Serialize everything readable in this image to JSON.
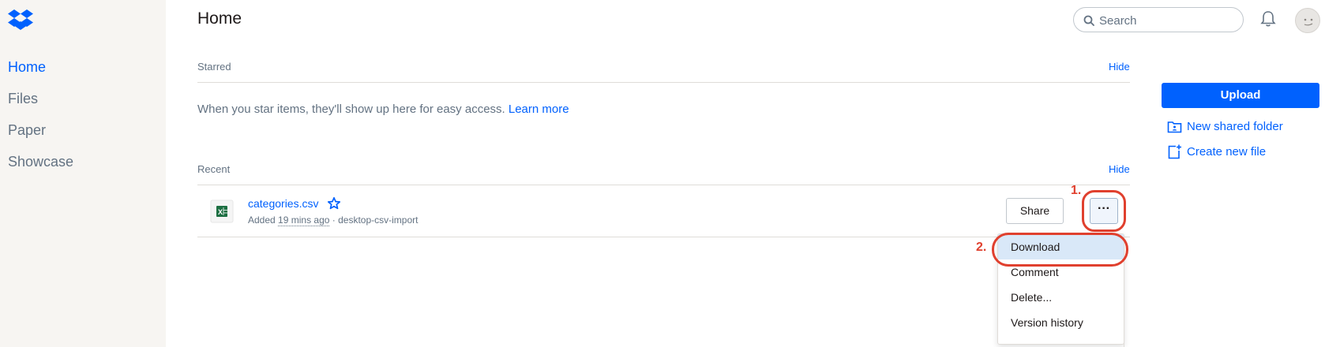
{
  "sidebar": {
    "items": [
      {
        "label": "Home",
        "active": true
      },
      {
        "label": "Files",
        "active": false
      },
      {
        "label": "Paper",
        "active": false
      },
      {
        "label": "Showcase",
        "active": false
      }
    ]
  },
  "header": {
    "title": "Home",
    "search_placeholder": "Search",
    "icons": [
      "search-icon",
      "bell-icon",
      "avatar"
    ]
  },
  "starred": {
    "label": "Starred",
    "hide_label": "Hide",
    "empty_text": "When you star items, they'll show up here for easy access.",
    "learn_more": "Learn more"
  },
  "recent": {
    "label": "Recent",
    "hide_label": "Hide",
    "files": [
      {
        "name": "categories.csv",
        "meta_prefix": "Added",
        "time": "19 mins ago",
        "meta_suffix": "· desktop-csv-import",
        "icon": "spreadsheet-icon",
        "share_label": "Share",
        "more_label": "···"
      }
    ]
  },
  "context_menu": {
    "items": [
      {
        "label": "Download",
        "highlighted": true
      },
      {
        "label": "Comment",
        "highlighted": false
      },
      {
        "label": "Delete...",
        "highlighted": false
      },
      {
        "label": "Version history",
        "highlighted": false
      }
    ]
  },
  "annotations": {
    "step1": "1.",
    "step2": "2."
  },
  "right_panel": {
    "upload_label": "Upload",
    "new_shared_folder": "New shared folder",
    "create_new_file": "Create new file"
  },
  "colors": {
    "accent": "#0061fe",
    "sidebar_bg": "#f7f5f2",
    "annotation": "#e0402e",
    "menu_highlight": "#d9e8f8"
  }
}
